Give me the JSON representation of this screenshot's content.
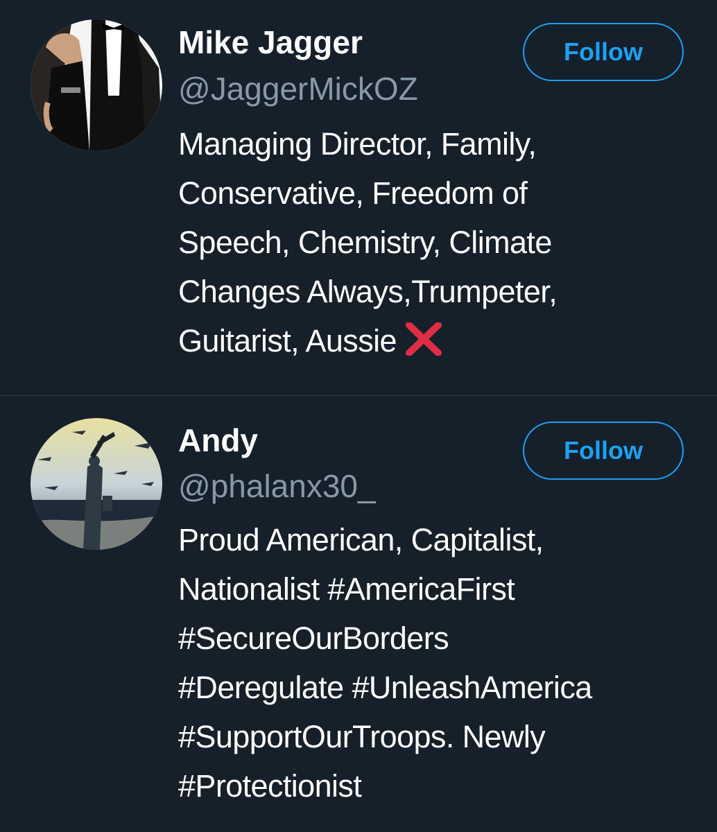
{
  "colors": {
    "background": "#15202b",
    "divider": "#38444d",
    "primary_text": "#ffffff",
    "secondary_text": "#8899a6",
    "accent": "#1da1f2",
    "x_mark": "#dd2e44"
  },
  "users": [
    {
      "display_name": "Mike Jagger",
      "handle": "@JaggerMickOZ",
      "follow_label": "Follow",
      "bio_lines": [
        "Managing Director, Family,",
        "Conservative, Freedom of",
        "Speech, Chemistry, Climate",
        "Changes Always,Trumpeter,",
        "Guitarist, Aussie"
      ],
      "bio_trailing_icon": "cross-mark-icon"
    },
    {
      "display_name": "Andy",
      "handle": "@phalanx30_",
      "follow_label": "Follow",
      "bio_lines": [
        "Proud American, Capitalist,",
        "Nationalist #AmericaFirst",
        "#SecureOurBorders",
        "#Deregulate #UnleashAmerica",
        "#SupportOurTroops. Newly",
        "#Protectionist"
      ]
    }
  ]
}
